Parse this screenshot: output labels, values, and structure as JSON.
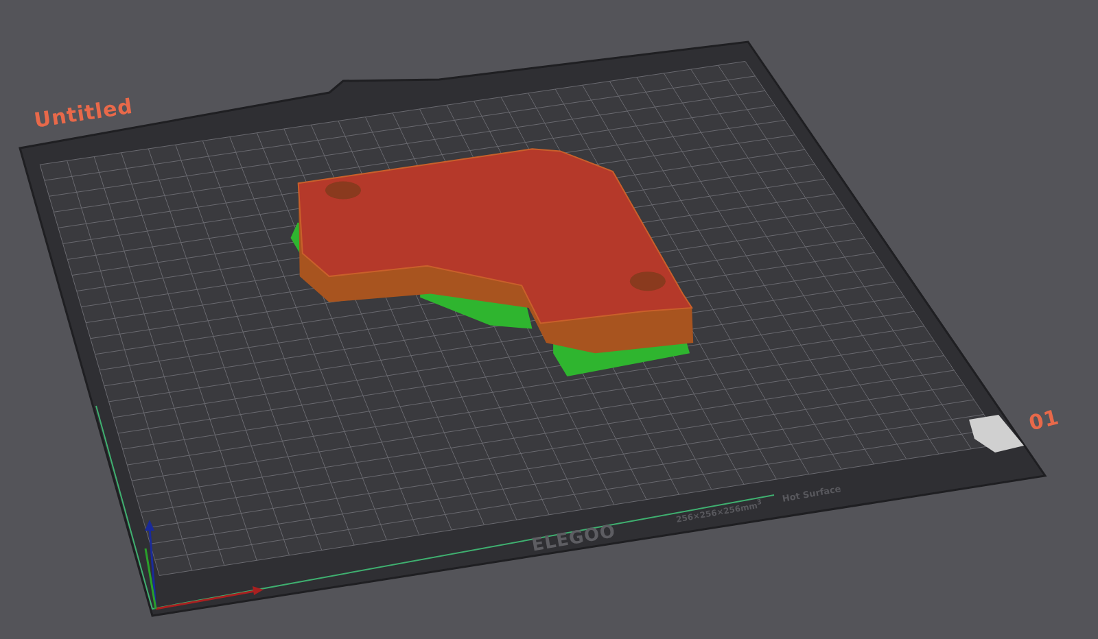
{
  "viewport": {
    "plate_name": "Untitled",
    "plate_number": "01"
  },
  "bed": {
    "brand": "ELEGOO",
    "size": "256×256×256mm$^{3}$",
    "warning": "Hot Surface"
  }
}
